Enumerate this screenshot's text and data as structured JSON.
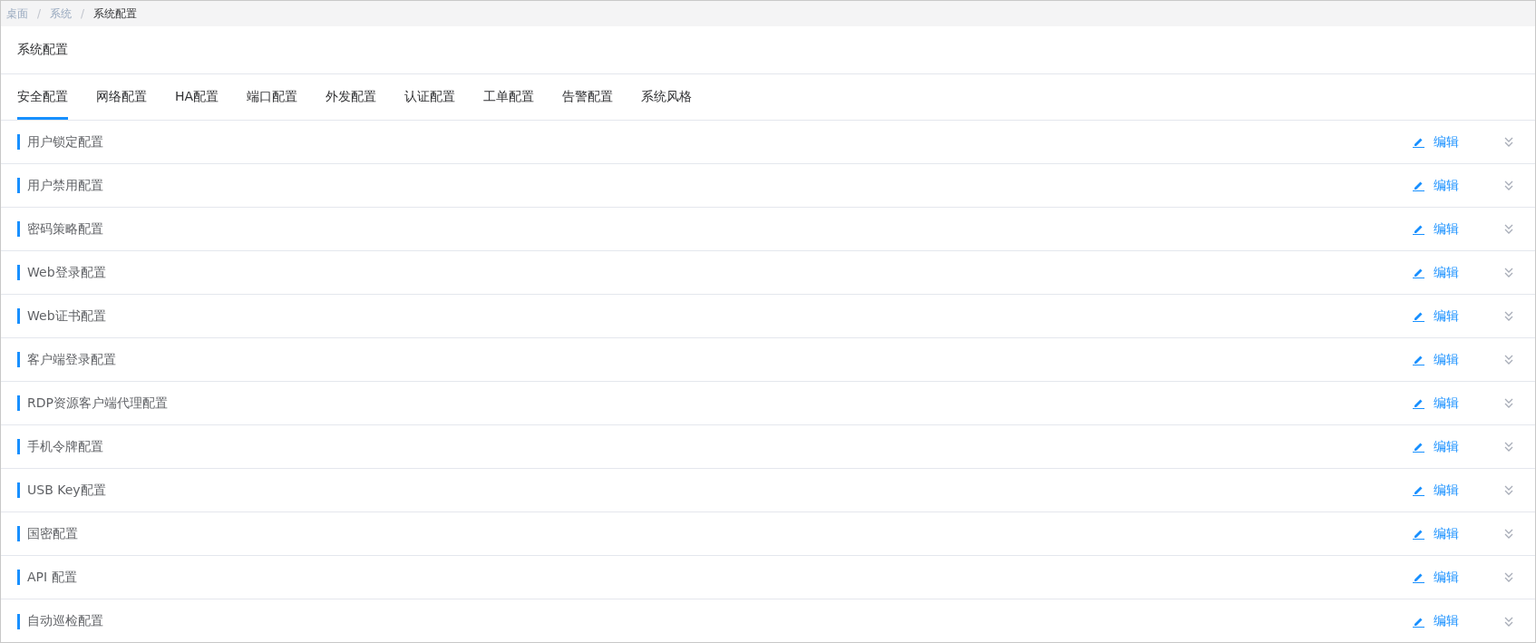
{
  "breadcrumb": [
    {
      "label": "桌面"
    },
    {
      "separator": "/",
      "label": "系统"
    },
    {
      "separator": "/",
      "label": "系统配置"
    }
  ],
  "page_title": "系统配置",
  "tabs": [
    {
      "label": "安全配置",
      "selected": true
    },
    {
      "label": "网络配置",
      "selected": false
    },
    {
      "label": "HA配置",
      "selected": false
    },
    {
      "label": "端口配置",
      "selected": false
    },
    {
      "label": "外发配置",
      "selected": false
    },
    {
      "label": "认证配置",
      "selected": false
    },
    {
      "label": "工单配置",
      "selected": false
    },
    {
      "label": "告警配置",
      "selected": false
    },
    {
      "label": "系统风格",
      "selected": false
    }
  ],
  "sections": [
    {
      "title": "用户锁定配置",
      "action": "编辑",
      "expanded": false
    },
    {
      "title": "用户禁用配置",
      "action": "编辑",
      "expanded": false
    },
    {
      "title": "密码策略配置",
      "action": "编辑",
      "expanded": false
    },
    {
      "title": "Web登录配置",
      "action": "编辑",
      "expanded": false
    },
    {
      "title": "Web证书配置",
      "action": "编辑",
      "expanded": false
    },
    {
      "title": "客户端登录配置",
      "action": "编辑",
      "expanded": false
    },
    {
      "title": "RDP资源客户端代理配置",
      "action": "编辑",
      "expanded": false
    },
    {
      "title": "手机令牌配置",
      "action": "编辑",
      "expanded": false
    },
    {
      "title": "USB Key配置",
      "action": "编辑",
      "expanded": false
    },
    {
      "title": "国密配置",
      "action": "编辑",
      "expanded": false
    },
    {
      "title": "API 配置",
      "action": "编辑",
      "expanded": false
    },
    {
      "title": "自动巡检配置",
      "action": "编辑",
      "expanded": false
    }
  ]
}
